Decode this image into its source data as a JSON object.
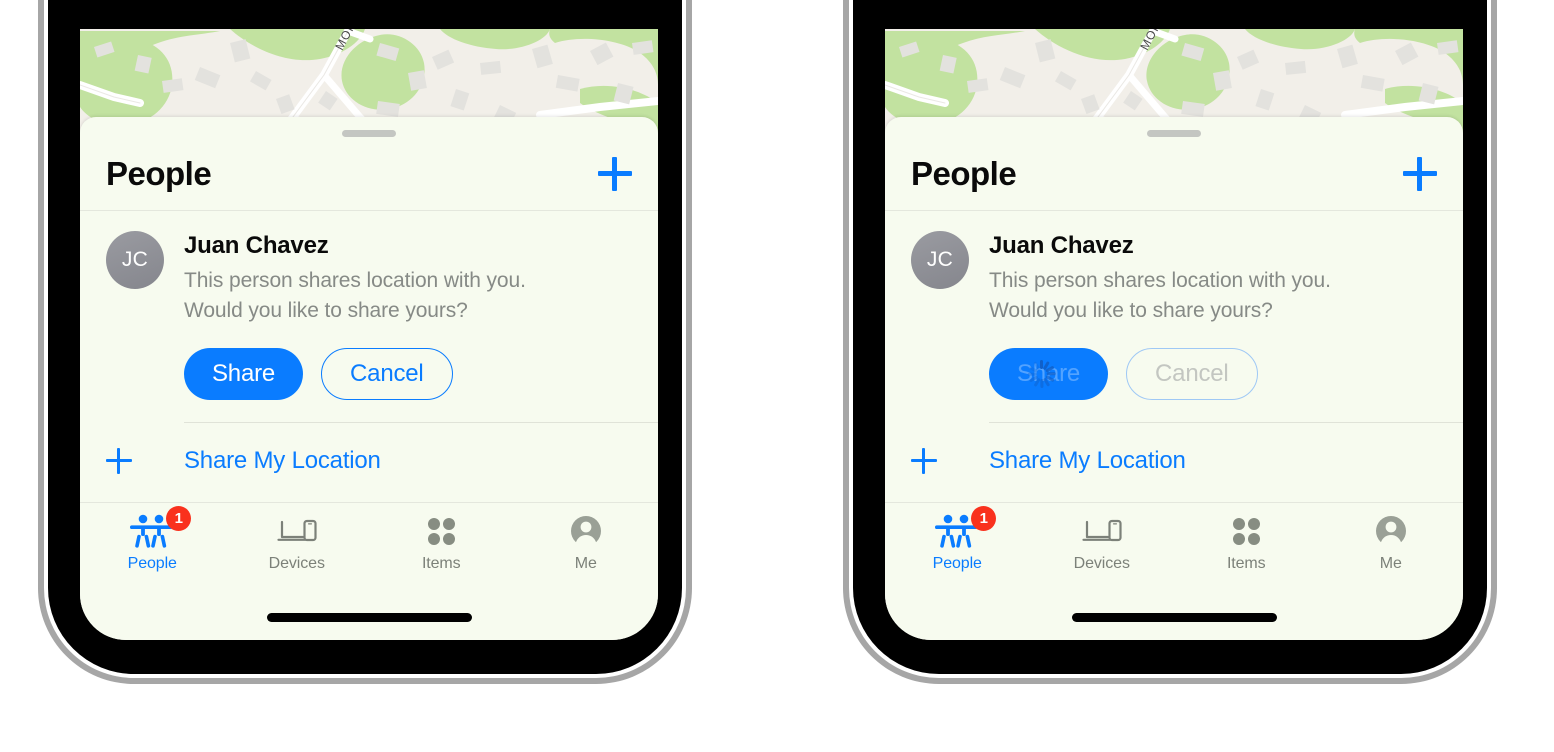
{
  "app": {
    "sheet_title": "People",
    "add_button_icon": "plus-icon"
  },
  "map": {
    "street_label": "MOREH",
    "colors": {
      "land": "#f2efe9",
      "green": "#c2e2a0",
      "road": "#ffffff",
      "building": "#e2e2de"
    }
  },
  "person": {
    "initials": "JC",
    "name": "Juan Chavez",
    "message_line1": "This person shares location with you.",
    "message_line2": "Would you like to share yours?",
    "share_label": "Share",
    "cancel_label": "Cancel"
  },
  "share_my_location": {
    "label": "Share My Location",
    "icon": "plus-icon"
  },
  "tabs": [
    {
      "label": "People",
      "icon": "two-people-icon",
      "active": true,
      "badge": "1"
    },
    {
      "label": "Devices",
      "icon": "laptop-phone-icon",
      "active": false,
      "badge": ""
    },
    {
      "label": "Items",
      "icon": "four-dots-icon",
      "active": false,
      "badge": ""
    },
    {
      "label": "Me",
      "icon": "person-circle-icon",
      "active": false,
      "badge": ""
    }
  ],
  "phones": [
    {
      "state": "idle",
      "caption": ""
    },
    {
      "state": "loading",
      "caption": ""
    }
  ],
  "colors": {
    "accent_blue": "#0a7cff",
    "badge_red": "#f9311d",
    "sheet_bg": "#f7fbef",
    "secondary_text": "#868a86",
    "tab_inactive": "#7c8179",
    "avatar_grey": "#8e8f95",
    "spinner_blue": "#1060c9"
  }
}
